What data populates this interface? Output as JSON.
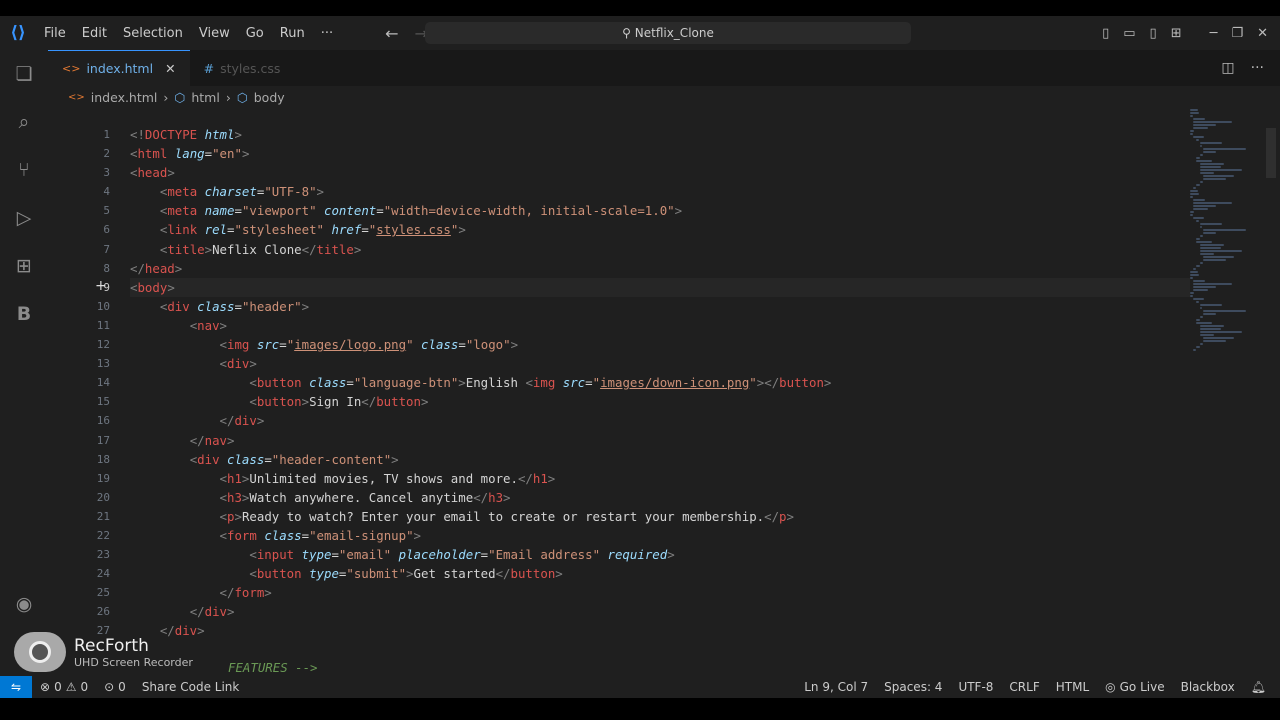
{
  "menu": {
    "items": [
      "File",
      "Edit",
      "Selection",
      "View",
      "Go",
      "Run",
      "···"
    ]
  },
  "search": {
    "title": "Netflix_Clone"
  },
  "tabs": [
    {
      "label": "index.html",
      "icon": "html-file-icon"
    },
    {
      "label": "styles.css",
      "icon": "css-file-icon"
    }
  ],
  "breadcrumb": {
    "file": "index.html",
    "items": [
      "html",
      "body"
    ]
  },
  "editor": {
    "current_line": 9,
    "line_numbers": [
      "1",
      "2",
      "3",
      "4",
      "5",
      "6",
      "7",
      "8",
      "9",
      "10",
      "11",
      "12",
      "13",
      "14",
      "15",
      "16",
      "17",
      "18",
      "19",
      "20",
      "21",
      "22",
      "23",
      "24",
      "25",
      "26",
      "27"
    ],
    "lines": [
      "<!DOCTYPE html>",
      "<html lang=\"en\">",
      "<head>",
      "    <meta charset=\"UTF-8\">",
      "    <meta name=\"viewport\" content=\"width=device-width, initial-scale=1.0\">",
      "    <link rel=\"stylesheet\" href=\"styles.css\">",
      "    <title>Neflix Clone</title>",
      "</head>",
      "<body>",
      "    <div class=\"header\">",
      "        <nav>",
      "            <img src=\"images/logo.png\" class=\"logo\">",
      "            <div>",
      "                <button class=\"language-btn\">English <img src=\"images/down-icon.png\"></button>",
      "                <button>Sign In</button>",
      "            </div>",
      "        </nav>",
      "        <div class=\"header-content\">",
      "            <h1>Unlimited movies, TV shows and more.</h1>",
      "            <h3>Watch anywhere. Cancel anytime</h3>",
      "            <p>Ready to watch? Enter your email to create or restart your membership.</p>",
      "            <form class=\"email-signup\">",
      "                <input type=\"email\" placeholder=\"Email address\" required>",
      "                <button type=\"submit\">Get started</button>",
      "            </form>",
      "        </div>",
      "    </div>"
    ],
    "partial_line": "FEATURES -->"
  },
  "overlay": {
    "title": "RecForth",
    "subtitle": "UHD Screen Recorder"
  },
  "status": {
    "errors": "0",
    "warnings": "0",
    "ports": "0",
    "share": "Share Code Link",
    "position": "Ln 9, Col 7",
    "spaces": "Spaces: 4",
    "encoding": "UTF-8",
    "eol": "CRLF",
    "language": "HTML",
    "golive": "Go Live",
    "blackbox": "Blackbox"
  },
  "colors": {
    "accent": "#3794ff",
    "tag": "#d9534f",
    "attr": "#9cdcfe",
    "string": "#ce9178",
    "remote": "#0078d4"
  }
}
